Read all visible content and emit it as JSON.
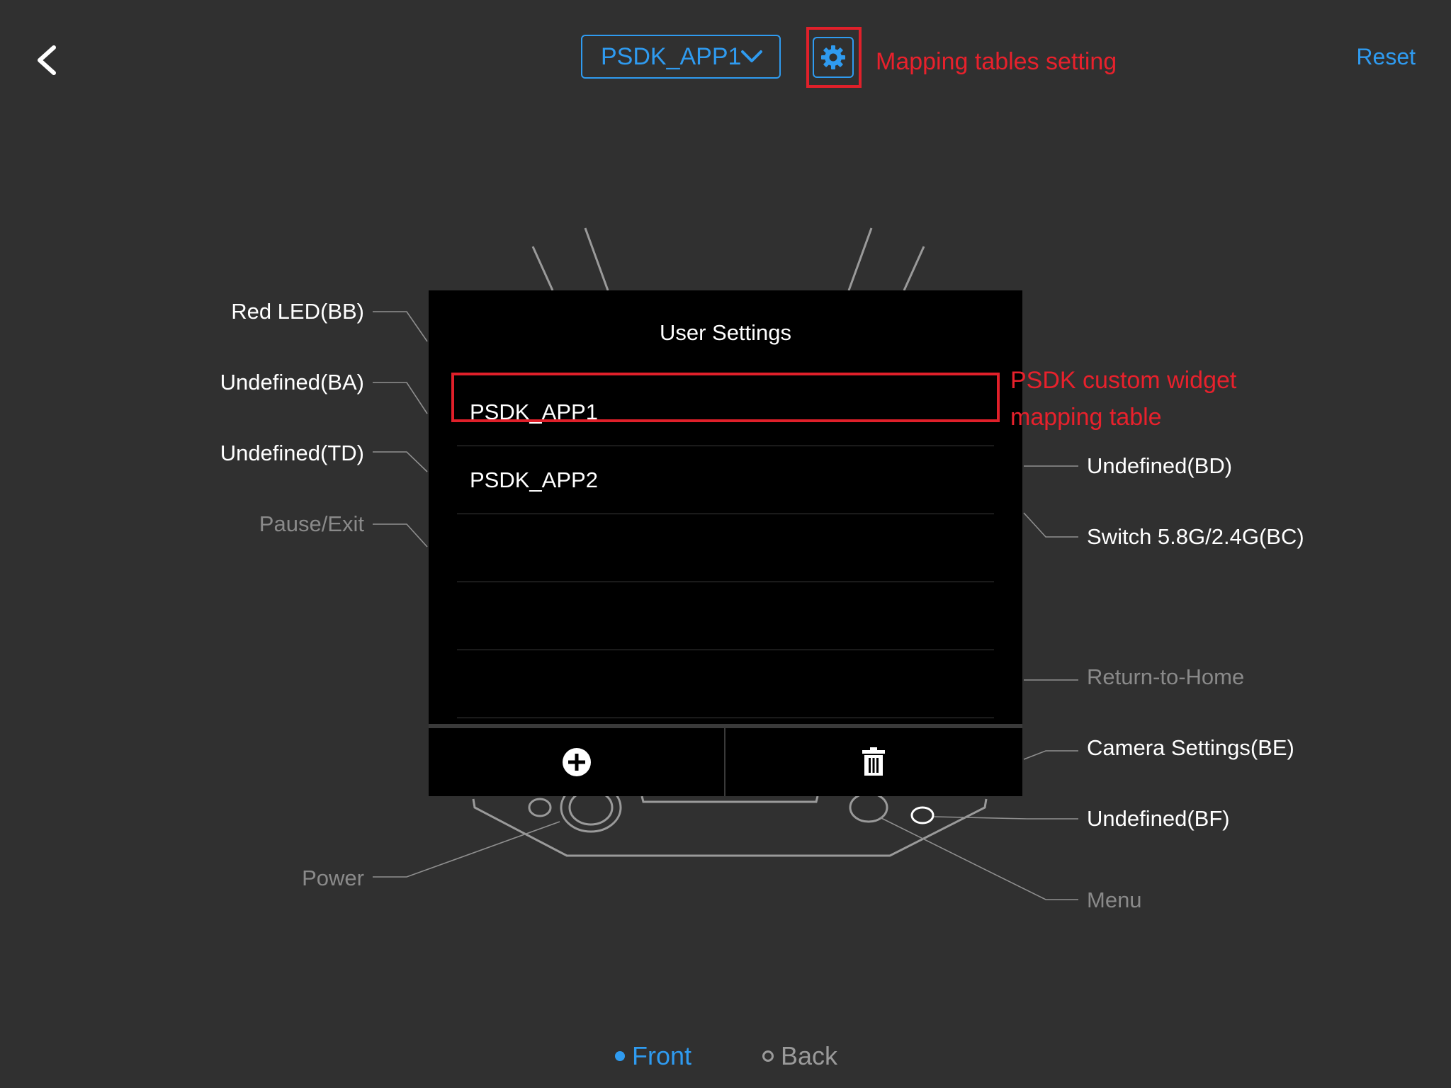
{
  "header": {
    "app_selected": "PSDK_APP1",
    "annotation_gear": "Mapping tables setting",
    "reset_label": "Reset"
  },
  "controller_labels": {
    "left": [
      "Red LED(BB)",
      "Undefined(BA)",
      "Undefined(TD)",
      "Pause/Exit",
      "Power"
    ],
    "right": [
      "Undefined(BD)",
      "Switch 5.8G/2.4G(BC)",
      "Return-to-Home",
      "Camera Settings(BE)",
      "Undefined(BF)",
      "Menu"
    ]
  },
  "dialog": {
    "title": "User Settings",
    "items": [
      "PSDK_APP1",
      "PSDK_APP2",
      "",
      "",
      ""
    ],
    "annotation_line1": "PSDK custom widget",
    "annotation_line2": "mapping table"
  },
  "view_toggle": {
    "front_label": "Front",
    "back_label": "Back",
    "selected": "Front"
  },
  "colors": {
    "background": "#303030",
    "accent": "#2f9bf0",
    "annotation": "#e0202a"
  },
  "icons": {
    "back": "chevron-left-icon",
    "dropdown": "chevron-down-icon",
    "settings": "gear-icon",
    "add": "plus-circle-icon",
    "delete": "trash-icon"
  }
}
